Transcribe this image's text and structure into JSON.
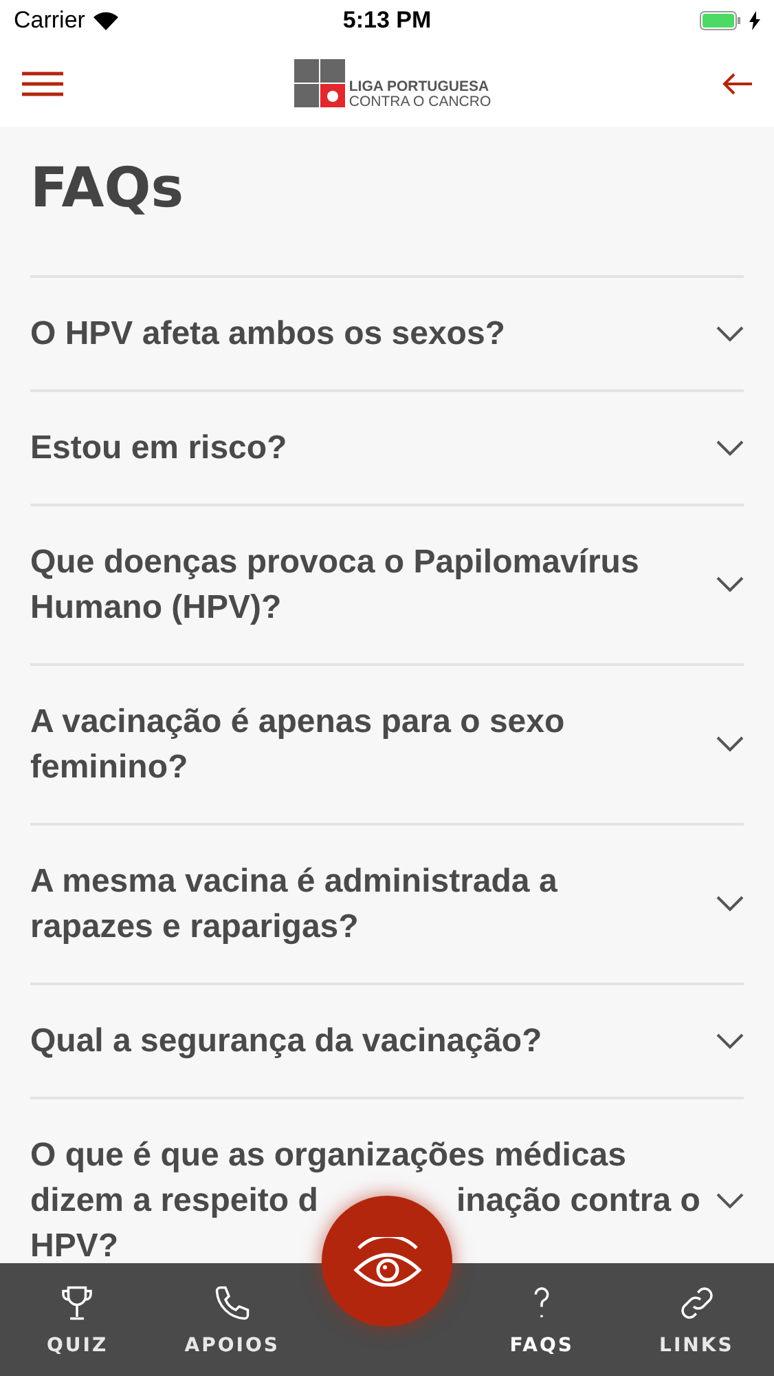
{
  "status_bar": {
    "carrier": "Carrier",
    "time": "5:13 PM",
    "battery": {
      "level": 1,
      "charging": true
    }
  },
  "header": {
    "logo_line_1": "LIGA PORTUGUESA",
    "logo_line_2": "CONTRA O CANCRO"
  },
  "title": "FAQs",
  "faqs": [
    {
      "question": "O HPV afeta ambos os sexos?",
      "expanded": false
    },
    {
      "question": "Estou em risco?",
      "expanded": false
    },
    {
      "question": "Que doenças provoca o Papilomavírus Humano (HPV)?",
      "expanded": false
    },
    {
      "question": "A vacinação é apenas para o sexo feminino?",
      "expanded": false
    },
    {
      "question": "A mesma vacina é administrada a rapazes e raparigas?",
      "expanded": false
    },
    {
      "question": "Qual a segurança da vacinação?",
      "expanded": false
    },
    {
      "kind": "partly_covered",
      "lines": [
        "O que é que as organizações médicas",
        "dizem a respeito d",
        "inação contra o",
        "HPV?"
      ],
      "expanded": false
    }
  ],
  "tab_bar": [
    {
      "kind": "trophy",
      "label": "QUIZ",
      "selected": false
    },
    {
      "kind": "phone",
      "label": "APOIOS",
      "selected": false
    },
    {
      "kind": "eye",
      "selected": false
    },
    {
      "kind": "question",
      "label": "FAQS",
      "selected": true
    },
    {
      "kind": "link",
      "label": "LINKS",
      "selected": false
    }
  ]
}
